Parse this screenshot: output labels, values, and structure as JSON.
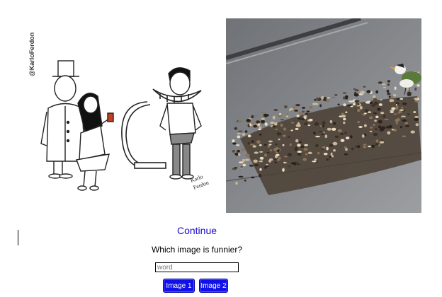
{
  "left_image": {
    "alt": "cartoon",
    "handle": "@KarloFerdon",
    "signature_line1": "Karlo",
    "signature_line2": "Ferdon"
  },
  "right_image": {
    "alt": "bird on street with scattered seeds"
  },
  "continue_link": "Continue",
  "question": "Which image is funnier?",
  "input": {
    "placeholder": "word",
    "value": ""
  },
  "buttons": {
    "image1": "Image 1",
    "image2": "Image 2"
  }
}
